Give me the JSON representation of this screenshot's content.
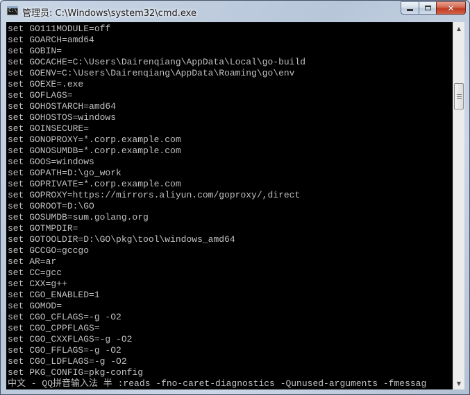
{
  "window": {
    "title": "管理员: C:\\Windows\\system32\\cmd.exe",
    "icon": "cmd-icon",
    "controls": [
      "minimize",
      "maximize",
      "close"
    ]
  },
  "console": {
    "lines": [
      "set GO111MODULE=off",
      "set GOARCH=amd64",
      "set GOBIN=",
      "set GOCACHE=C:\\Users\\Dairenqiang\\AppData\\Local\\go-build",
      "set GOENV=C:\\Users\\Dairenqiang\\AppData\\Roaming\\go\\env",
      "set GOEXE=.exe",
      "set GOFLAGS=",
      "set GOHOSTARCH=amd64",
      "set GOHOSTOS=windows",
      "set GOINSECURE=",
      "set GONOPROXY=*.corp.example.com",
      "set GONOSUMDB=*.corp.example.com",
      "set GOOS=windows",
      "set GOPATH=D:\\go_work",
      "set GOPRIVATE=*.corp.example.com",
      "set GOPROXY=https://mirrors.aliyun.com/goproxy/,direct",
      "set GOROOT=D:\\GO",
      "set GOSUMDB=sum.golang.org",
      "set GOTMPDIR=",
      "set GOTOOLDIR=D:\\GO\\pkg\\tool\\windows_amd64",
      "set GCCGO=gccgo",
      "set AR=ar",
      "set CC=gcc",
      "set CXX=g++",
      "set CGO_ENABLED=1",
      "set GOMOD=",
      "set CGO_CFLAGS=-g -O2",
      "set CGO_CPPFLAGS=",
      "set CGO_CXXFLAGS=-g -O2",
      "set CGO_FFLAGS=-g -O2",
      "set CGO_LDFLAGS=-g -O2",
      "set PKG_CONFIG=pkg-config"
    ],
    "ime_line": "中文 - QQ拼音输入法 半 :reads -fno-caret-diagnostics -Qunused-arguments -fmessag",
    "text_color": "#c0c0c0",
    "background": "#000000"
  }
}
